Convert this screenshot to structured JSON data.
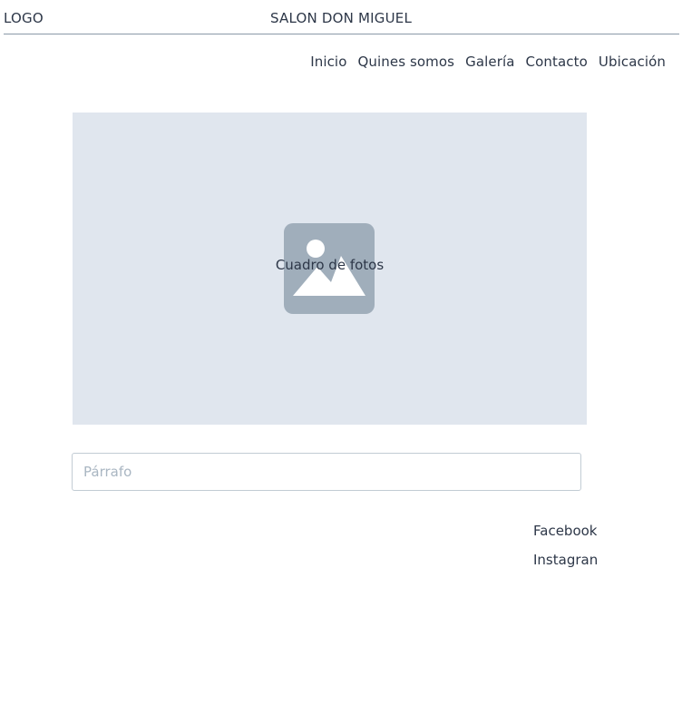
{
  "header": {
    "logo": "LOGO",
    "title": "SALON DON MIGUEL"
  },
  "nav": {
    "items": [
      {
        "label": "Inicio"
      },
      {
        "label": "Quines somos"
      },
      {
        "label": "Galería"
      },
      {
        "label": "Contacto"
      },
      {
        "label": "Ubicación"
      }
    ]
  },
  "gallery": {
    "caption": "Cuadro de fotos",
    "icon": "image-placeholder-icon"
  },
  "paragraph": {
    "placeholder": "Párrafo",
    "value": ""
  },
  "social": {
    "links": [
      {
        "label": "Facebook"
      },
      {
        "label": "Instagran"
      }
    ]
  },
  "colors": {
    "text": "#2d3748",
    "divider": "#8a99a8",
    "photo_bg": "#e0e6ee",
    "icon": "#a0aebb",
    "input_border": "#c2ccd4",
    "placeholder": "#a9b6c2"
  }
}
